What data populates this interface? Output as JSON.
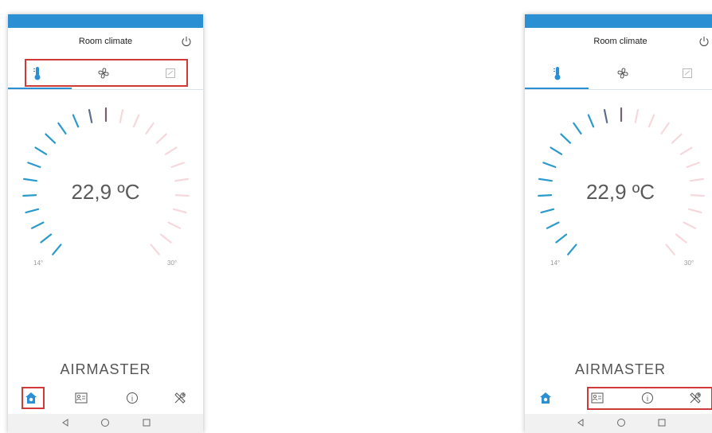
{
  "screens": [
    {
      "title": "Room climate",
      "temperature": "22,9 ºC",
      "min_label": "14°",
      "max_label": "30°",
      "brand": "AIRMASTER",
      "tabs": [
        "thermometer-icon",
        "fan-icon",
        "note-icon"
      ],
      "nav": [
        "home-icon",
        "contact-card-icon",
        "info-icon",
        "tools-icon"
      ],
      "highlight": "tabs-and-home"
    },
    {
      "title": "Room climate",
      "temperature": "22,9 ºC",
      "min_label": "14°",
      "max_label": "30°",
      "brand": "AIRMASTER",
      "tabs": [
        "thermometer-icon",
        "fan-icon",
        "note-icon"
      ],
      "nav": [
        "home-icon",
        "contact-card-icon",
        "info-icon",
        "tools-icon"
      ],
      "highlight": "nav-secondary"
    }
  ],
  "colors": {
    "accent": "#2b8fd3",
    "cold_ticks": "#2a9acb",
    "warm_ticks": "#f6d8dc",
    "highlight": "#d23a3a"
  }
}
